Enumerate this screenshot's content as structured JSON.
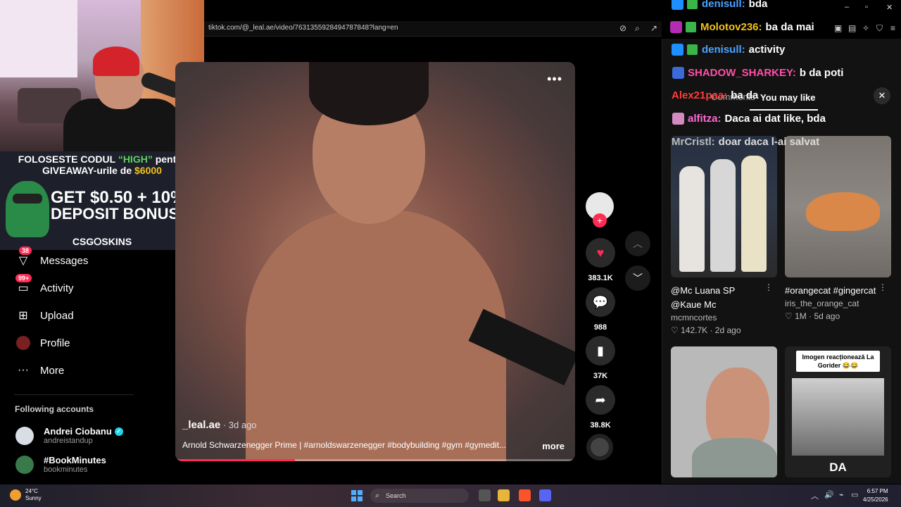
{
  "browser": {
    "url": "tiktok.com/@_leal.ae/video/7631355928494787848?lang=en",
    "minimize_glyph": "–",
    "maximize_glyph": "▫",
    "close_glyph": "✕"
  },
  "webcam": {
    "promo_line1_prefix": "FOLOSESTE CODUL",
    "promo_code": "“HIGH”",
    "promo_line1_suffix": "pentru",
    "promo_line2_prefix": "GIVEAWAY-urile de",
    "promo_amount": "$6000",
    "promo_big1": "GET $0.50 + 10%",
    "promo_big2": "DEPOSIT BONUS",
    "promo_brand": "CSG⭘SKINS"
  },
  "sidebar": {
    "items": [
      {
        "label": "Messages",
        "badge": "38",
        "icon": "messages-icon"
      },
      {
        "label": "Activity",
        "badge": "99+",
        "icon": "activity-icon"
      },
      {
        "label": "Upload",
        "badge": "",
        "icon": "upload-icon"
      },
      {
        "label": "Profile",
        "badge": "",
        "icon": "profile-icon"
      },
      {
        "label": "More",
        "badge": "",
        "icon": "more-icon"
      }
    ],
    "following_title": "Following accounts",
    "following": [
      {
        "name": "Andrei Ciobanu",
        "handle": "andreistandup",
        "verified": true
      },
      {
        "name": "#BookMinutes",
        "handle": "bookminutes",
        "verified": false
      }
    ]
  },
  "video": {
    "author": "_leal.ae",
    "posted": " · 3d ago",
    "caption": "Arnold Schwarzenegger Prime | #arnoldswarzenegger #bodybuilding #gym #gymedit...",
    "more_label": "more",
    "menu_glyph": "•••",
    "progress": 0.3
  },
  "actions": {
    "likes": "383.1K",
    "comments": "988",
    "saves": "37K",
    "shares": "38.8K"
  },
  "panel": {
    "tab_comments": "Comments",
    "tab_you_may_like": "You may like",
    "close_glyph": "✕",
    "cards": [
      {
        "title": "@Mc Luana SP @Kaue Mc",
        "user": "mcmncortes",
        "likes": "♡ 142.7K",
        "age": "2d ago"
      },
      {
        "title": "#orangecat #gingercat",
        "user": "iris_the_orange_cat",
        "likes": "♡ 1M",
        "age": "5d ago"
      },
      {
        "title": "",
        "user": "",
        "likes": "",
        "age": ""
      },
      {
        "title": "",
        "overlay": "Imogen reacționează La Gorider 😂😂",
        "bottom": "DA",
        "user": "",
        "likes": "",
        "age": ""
      }
    ]
  },
  "chat": [
    {
      "user": "denisull:",
      "msg": "bda",
      "color": "#4aa3ff"
    },
    {
      "user": "Molotov236:",
      "msg": "ba da mai",
      "color": "#f2c21b"
    },
    {
      "user": "denisull:",
      "msg": "activity",
      "color": "#4aa3ff"
    },
    {
      "user": "SHADOW_SHARKEY:",
      "msg": "b da poti",
      "color": "#ff4fa8"
    },
    {
      "user": "Alex21paa:",
      "msg": "ba da",
      "color": "#ff3b3b"
    },
    {
      "user": "alfitza:",
      "msg": "Daca ai dat like, bda",
      "color": "#ff6ad5"
    },
    {
      "user": "MrCristl:",
      "msg": "doar daca l-ai salvat",
      "color": "#bbbbbb"
    }
  ],
  "taskbar": {
    "temp": "24°C",
    "condition": "Sunny",
    "search_placeholder": "Search",
    "time": "6:57 PM",
    "date": "4/25/2026"
  }
}
